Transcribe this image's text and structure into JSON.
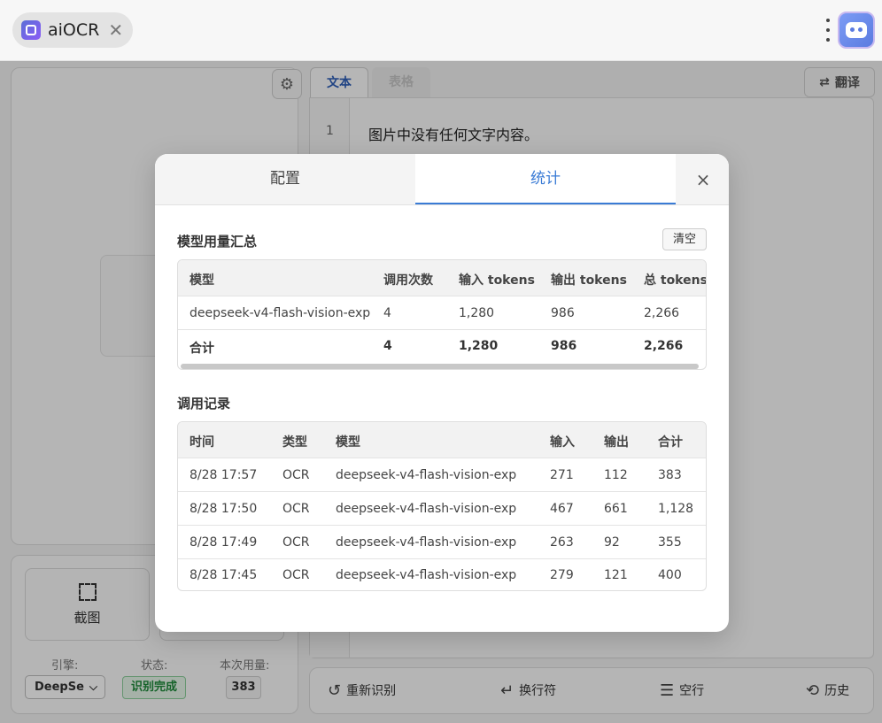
{
  "window": {
    "tab_title": "aiOCR",
    "tab_close_glyph": "✕",
    "app_icon": "app-logo-icon",
    "menu_icon": "more-vertical-icon",
    "profile_icon": "robot-avatar-icon"
  },
  "left_panel": {
    "screenshot_label": "截图",
    "engine_label": "引擎:",
    "engine_value": "DeepSe",
    "status_label": "状态:",
    "status_value": "识别完成",
    "usage_label": "本次用量:",
    "usage_value": "383",
    "status_color": "#1f8a3b"
  },
  "result_panel": {
    "tabs": [
      {
        "label": "文本"
      },
      {
        "label": "表格"
      }
    ],
    "translate_label": "翻译",
    "lines": [
      {
        "number": "1",
        "text": "图片中没有任何文字内容。"
      }
    ],
    "actions": {
      "rerecognize": "重新识别",
      "linebreak": "换行符",
      "blankline": "空行",
      "history": "历史"
    }
  },
  "modal": {
    "tabs": [
      {
        "label": "配置"
      },
      {
        "label": "统计"
      }
    ],
    "active_tab": "统计",
    "accent_color": "#3a7bd5",
    "close_glyph": "×",
    "summary": {
      "title": "模型用量汇总",
      "clear_label": "清空",
      "headers": [
        "模型",
        "调用次数",
        "输入 tokens",
        "输出 tokens",
        "总 tokens"
      ],
      "rows": [
        [
          "deepseek-v4-flash-vision-exp",
          "4",
          "1,280",
          "986",
          "2,266"
        ]
      ],
      "total": [
        "合计",
        "4",
        "1,280",
        "986",
        "2,266"
      ]
    },
    "log": {
      "title": "调用记录",
      "headers": [
        "时间",
        "类型",
        "模型",
        "输入",
        "输出",
        "合计"
      ],
      "rows": [
        [
          "8/28 17:57",
          "OCR",
          "deepseek-v4-flash-vision-exp",
          "271",
          "112",
          "383"
        ],
        [
          "8/28 17:50",
          "OCR",
          "deepseek-v4-flash-vision-exp",
          "467",
          "661",
          "1,128"
        ],
        [
          "8/28 17:49",
          "OCR",
          "deepseek-v4-flash-vision-exp",
          "263",
          "92",
          "355"
        ],
        [
          "8/28 17:45",
          "OCR",
          "deepseek-v4-flash-vision-exp",
          "279",
          "121",
          "400"
        ]
      ]
    }
  }
}
